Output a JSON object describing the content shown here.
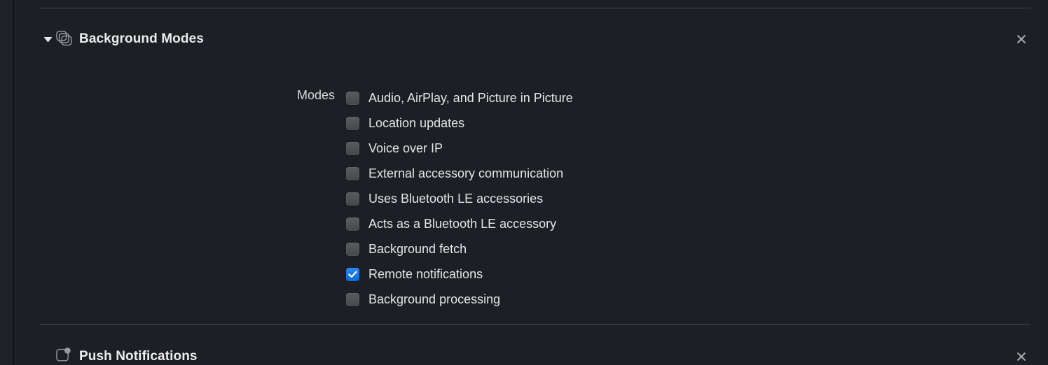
{
  "theme": {
    "background": "#1d1f24",
    "gutter": "#202227",
    "rule": "#46484d",
    "text_primary": "#e4e5e7",
    "text_heading": "#ebecee",
    "accent_blue": "#0a6fe0",
    "checkbox_off": "#4f5155",
    "icon_stroke": "#9a9ca0"
  },
  "capabilities": [
    {
      "id": "background-modes",
      "title": "Background Modes",
      "icon": "stacked-squares-icon",
      "expanded": true,
      "disclosure_glyph": "▼",
      "close_label": "×",
      "field": {
        "label": "Modes",
        "options": [
          {
            "label": "Audio, AirPlay, and Picture in Picture",
            "checked": false
          },
          {
            "label": "Location updates",
            "checked": false
          },
          {
            "label": "Voice over IP",
            "checked": false
          },
          {
            "label": "External accessory communication",
            "checked": false
          },
          {
            "label": "Uses Bluetooth LE accessories",
            "checked": false
          },
          {
            "label": "Acts as a Bluetooth LE accessory",
            "checked": false
          },
          {
            "label": "Background fetch",
            "checked": false
          },
          {
            "label": "Remote notifications",
            "checked": true
          },
          {
            "label": "Background processing",
            "checked": false
          }
        ]
      }
    },
    {
      "id": "push-notifications",
      "title": "Push Notifications",
      "icon": "badge-app-icon",
      "expanded": false,
      "close_label": "×"
    }
  ]
}
